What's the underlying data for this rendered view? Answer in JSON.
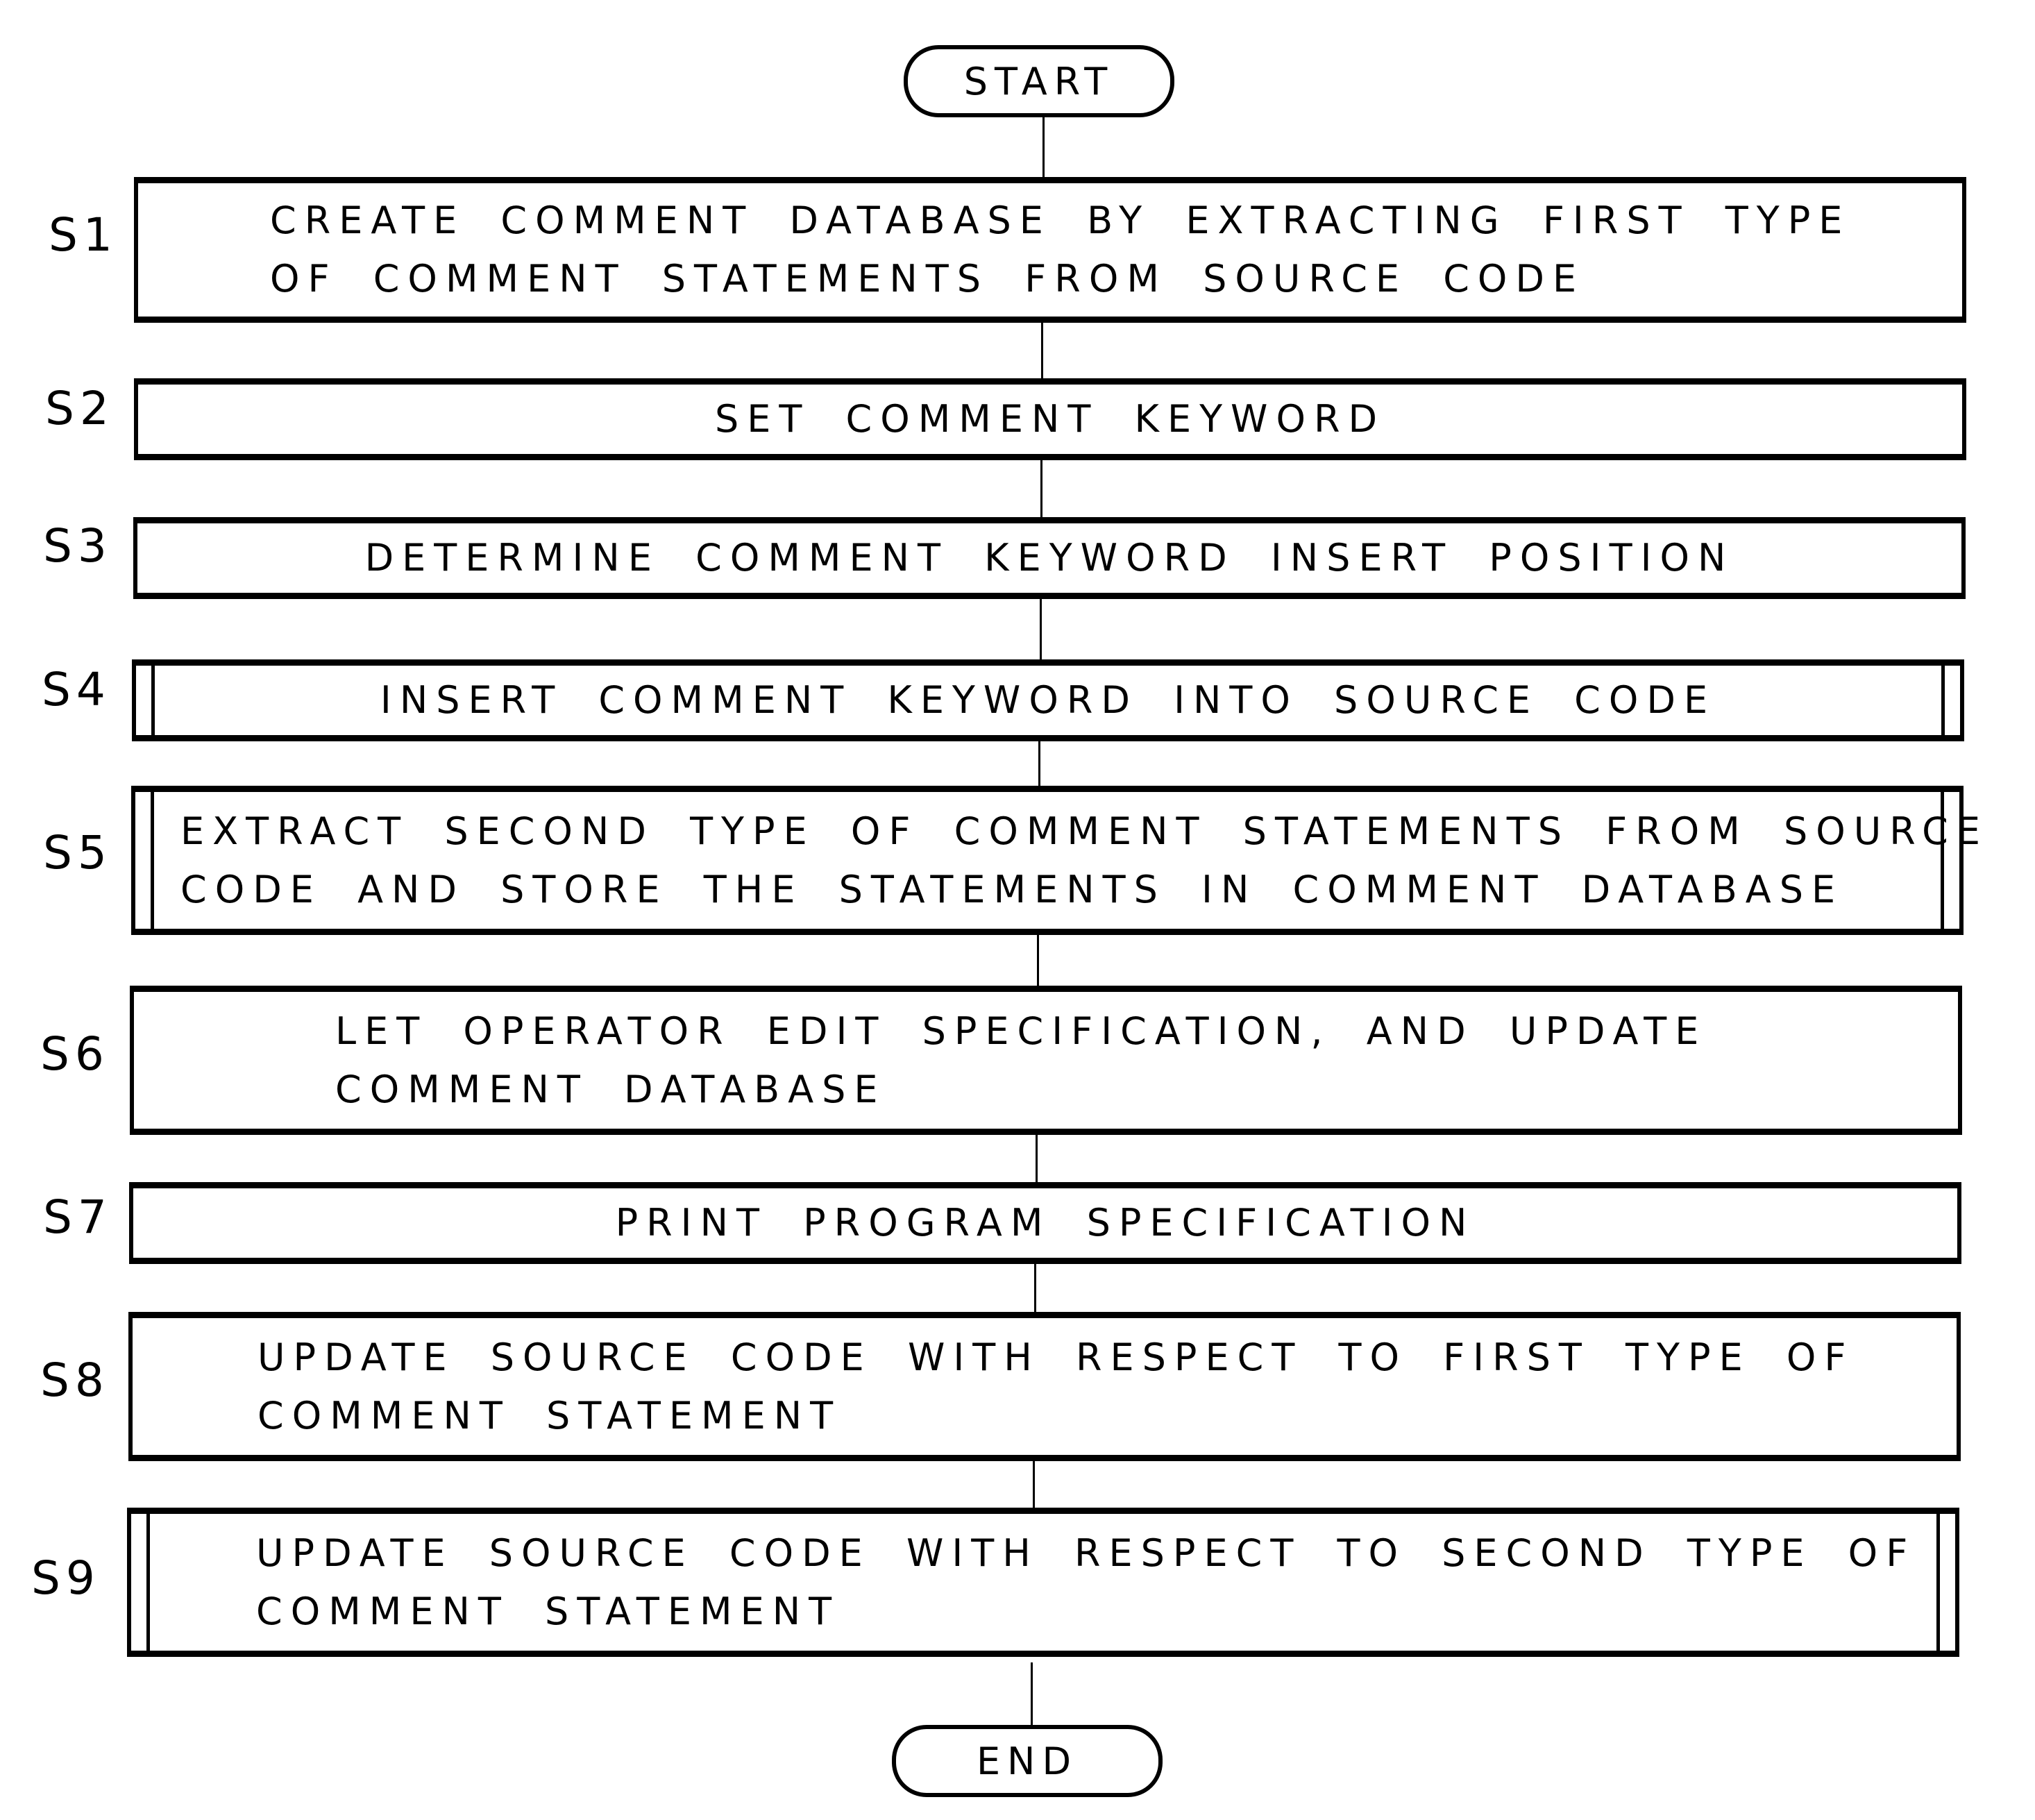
{
  "flowchart": {
    "start": "START",
    "end": "END",
    "steps": [
      {
        "id": "S1",
        "lines": [
          "CREATE COMMENT DATABASE BY EXTRACTING FIRST TYPE",
          "OF COMMENT STATEMENTS FROM SOURCE CODE"
        ],
        "type": "process"
      },
      {
        "id": "S2",
        "lines": [
          "SET COMMENT KEYWORD"
        ],
        "type": "process"
      },
      {
        "id": "S3",
        "lines": [
          "DETERMINE COMMENT KEYWORD INSERT POSITION"
        ],
        "type": "process"
      },
      {
        "id": "S4",
        "lines": [
          "INSERT COMMENT KEYWORD INTO SOURCE CODE"
        ],
        "type": "predefined-process"
      },
      {
        "id": "S5",
        "lines": [
          "EXTRACT SECOND TYPE OF COMMENT STATEMENTS FROM SOURCE",
          "CODE AND STORE THE STATEMENTS IN COMMENT DATABASE"
        ],
        "type": "predefined-process"
      },
      {
        "id": "S6",
        "lines": [
          "LET OPERATOR EDIT SPECIFICATION, AND UPDATE",
          "COMMENT DATABASE"
        ],
        "type": "process"
      },
      {
        "id": "S7",
        "lines": [
          "PRINT PROGRAM SPECIFICATION"
        ],
        "type": "process"
      },
      {
        "id": "S8",
        "lines": [
          "UPDATE SOURCE CODE WITH RESPECT TO FIRST TYPE OF",
          "COMMENT STATEMENT"
        ],
        "type": "process"
      },
      {
        "id": "S9",
        "lines": [
          "UPDATE SOURCE CODE WITH RESPECT TO SECOND TYPE OF",
          "COMMENT STATEMENT"
        ],
        "type": "predefined-process"
      }
    ]
  }
}
